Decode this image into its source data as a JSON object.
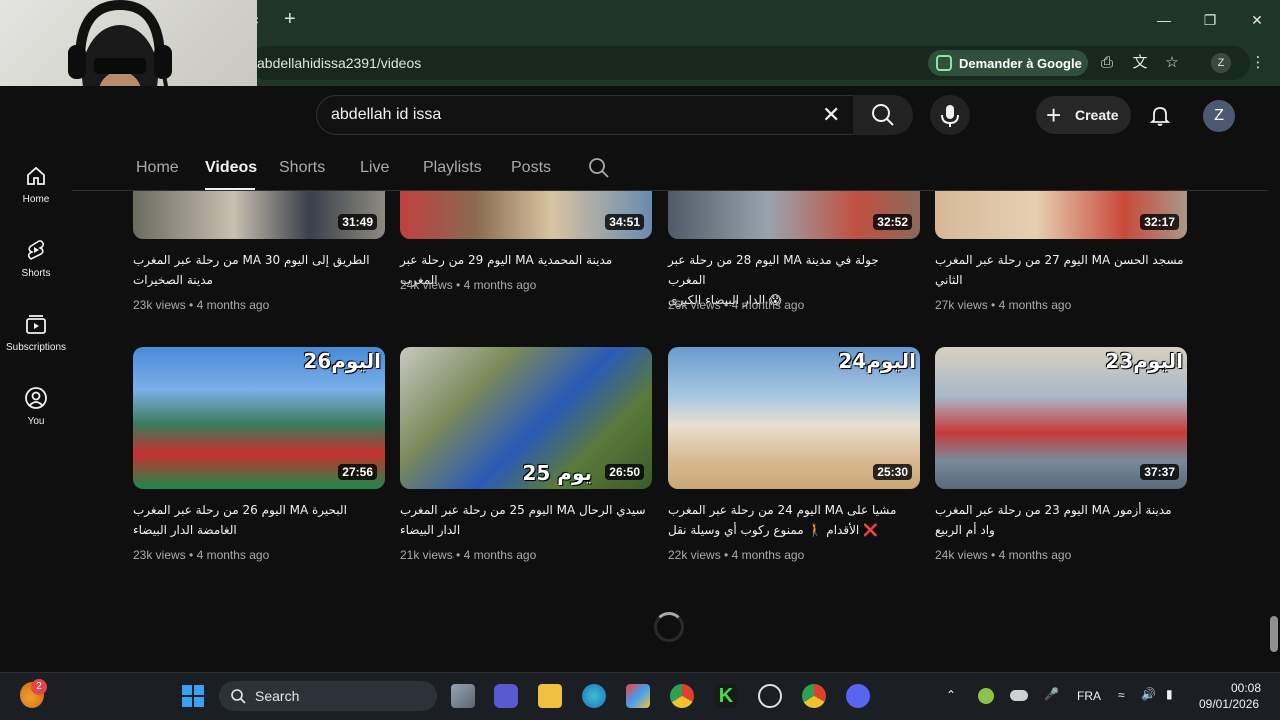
{
  "browser": {
    "url": "abdellahidissa2391/videos",
    "google_button": "Demander à Google",
    "profile_letter": "Z",
    "tab_close": "×",
    "new_tab": "+"
  },
  "youtube": {
    "search_value": "abdellah id issa",
    "create_label": "Create",
    "avatar_letter": "Z"
  },
  "nav": [
    {
      "label": "Home"
    },
    {
      "label": "Shorts"
    },
    {
      "label": "Subscriptions"
    },
    {
      "label": "You"
    }
  ],
  "tabs": [
    "Home",
    "Videos",
    "Shorts",
    "Live",
    "Playlists",
    "Posts"
  ],
  "videos_row1": [
    {
      "duration": "31:49",
      "title1": "الطريق إلى اليوم 30 MA من رحلة عبر المغرب",
      "title2": "مدينة الصخيرات",
      "views": "23k views",
      "age": "4 months ago"
    },
    {
      "duration": "34:51",
      "title1": "مدينة المحمدية MA اليوم 29 من رحلة عبر المغرب",
      "title2": "",
      "views": "24k views",
      "age": "4 months ago"
    },
    {
      "duration": "32:52",
      "title1": "جولة في مدينة MA اليوم 28 من رحلة عبر المغرب",
      "title2": "😱 الدار البيضاء الكبرى",
      "views": "26k views",
      "age": "4 months ago"
    },
    {
      "duration": "32:17",
      "title1": "مسجد الحسن MA اليوم 27 من رحلة عبر المغرب",
      "title2": "الثاني",
      "views": "27k views",
      "age": "4 months ago"
    }
  ],
  "videos_row2": [
    {
      "duration": "27:56",
      "badge": "اليوم26",
      "title1": "البحيرة MA اليوم 26 من رحلة عبر المغرب",
      "title2": "الغامضة الدار البيضاء",
      "views": "23k views",
      "age": "4 months ago"
    },
    {
      "duration": "26:50",
      "badge": "25 يوم",
      "title1": "سيدي الرحال MA اليوم 25 من رحلة عبر المغرب",
      "title2": "الدار البيضاء",
      "views": "21k views",
      "age": "4 months ago"
    },
    {
      "duration": "25:30",
      "badge": "اليوم24",
      "title1": "مشيا على MA اليوم 24 من رحلة عبر المغرب",
      "title2": "❌ الأقدام 🚶 ممنوع ركوب أي وسيلة نقل",
      "views": "22k views",
      "age": "4 months ago"
    },
    {
      "duration": "37:37",
      "badge": "اليوم23",
      "title1": "مدينة أزمور MA اليوم 23 من رحلة عبر المغرب",
      "title2": "واد أم الربيع",
      "views": "24k views",
      "age": "4 months ago"
    }
  ],
  "taskbar": {
    "search_label": "Search",
    "badge_count": "2",
    "language": "FRA",
    "time": "00:08",
    "date": "09/01/2026"
  }
}
